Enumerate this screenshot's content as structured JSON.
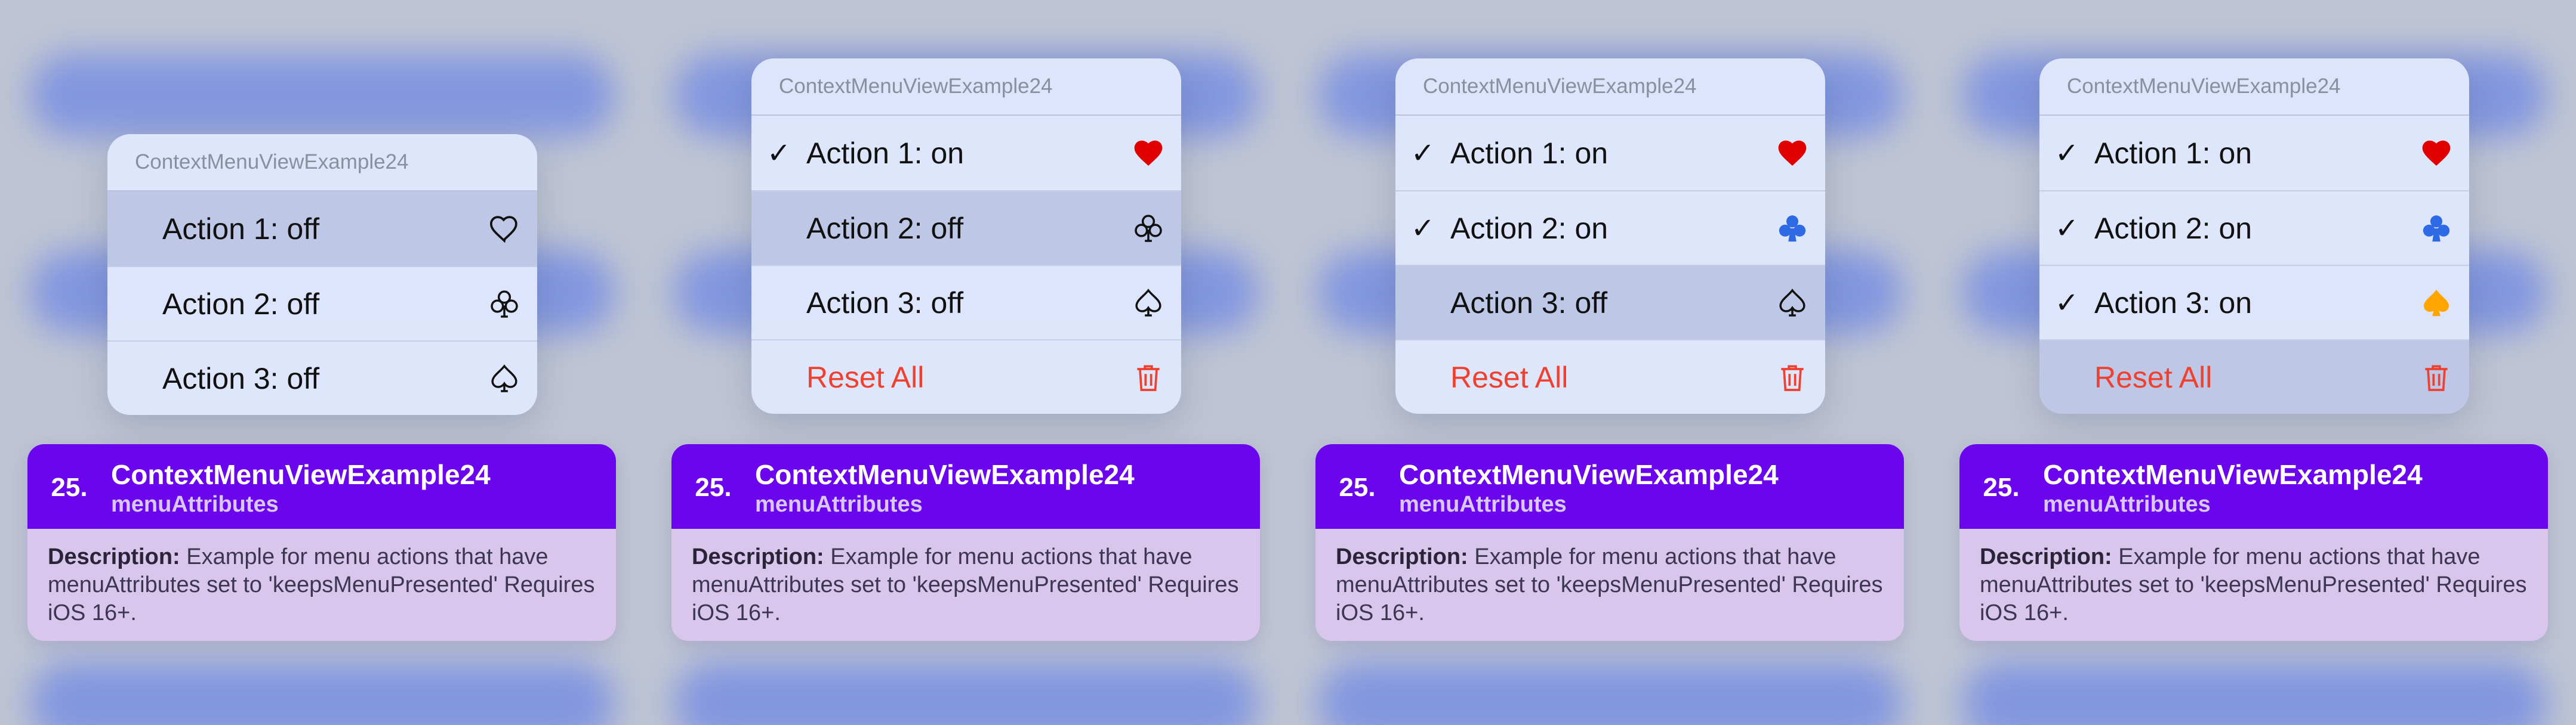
{
  "colors": {
    "accent": "#6a05ee",
    "destructive": "#f0402f",
    "heart": "#e00000",
    "club": "#2f6ae6",
    "spade": "#ffa500"
  },
  "panels": [
    {
      "menu": {
        "title": "ContextMenuViewExample24",
        "items": [
          {
            "check": "",
            "label": "Action 1: off",
            "icon": "heart-outline-icon"
          },
          {
            "check": "",
            "label": "Action 2: off",
            "icon": "club-outline-icon"
          },
          {
            "check": "",
            "label": "Action 3: off",
            "icon": "spade-outline-icon"
          }
        ]
      },
      "card": {
        "number": "25.",
        "title": "ContextMenuViewExample24",
        "subtitle": "menuAttributes",
        "description_label": "Description:",
        "description": "Example for menu actions that have menuAttributes set to 'keepsMenuPresented' Requires iOS 16+."
      }
    },
    {
      "menu": {
        "title": "ContextMenuViewExample24",
        "items": [
          {
            "check": "✓",
            "label": "Action 1: on",
            "icon": "heart-filled-icon"
          },
          {
            "check": "",
            "label": "Action 2: off",
            "icon": "club-outline-icon"
          },
          {
            "check": "",
            "label": "Action 3: off",
            "icon": "spade-outline-icon"
          },
          {
            "check": "",
            "label": "Reset All",
            "icon": "trash-icon"
          }
        ]
      },
      "card": {
        "number": "25.",
        "title": "ContextMenuViewExample24",
        "subtitle": "menuAttributes",
        "description_label": "Description:",
        "description": "Example for menu actions that have menuAttributes set to 'keepsMenuPresented' Requires iOS 16+."
      }
    },
    {
      "menu": {
        "title": "ContextMenuViewExample24",
        "items": [
          {
            "check": "✓",
            "label": "Action 1: on",
            "icon": "heart-filled-icon"
          },
          {
            "check": "✓",
            "label": "Action 2: on",
            "icon": "club-filled-icon"
          },
          {
            "check": "",
            "label": "Action 3: off",
            "icon": "spade-outline-icon"
          },
          {
            "check": "",
            "label": "Reset All",
            "icon": "trash-icon"
          }
        ]
      },
      "card": {
        "number": "25.",
        "title": "ContextMenuViewExample24",
        "subtitle": "menuAttributes",
        "description_label": "Description:",
        "description": "Example for menu actions that have menuAttributes set to 'keepsMenuPresented' Requires iOS 16+."
      }
    },
    {
      "menu": {
        "title": "ContextMenuViewExample24",
        "items": [
          {
            "check": "✓",
            "label": "Action 1: on",
            "icon": "heart-filled-icon"
          },
          {
            "check": "✓",
            "label": "Action 2: on",
            "icon": "club-filled-icon"
          },
          {
            "check": "✓",
            "label": "Action 3: on",
            "icon": "spade-filled-icon"
          },
          {
            "check": "",
            "label": "Reset All",
            "icon": "trash-icon"
          }
        ]
      },
      "card": {
        "number": "25.",
        "title": "ContextMenuViewExample24",
        "subtitle": "menuAttributes",
        "description_label": "Description:",
        "description": "Example for menu actions that have menuAttributes set to 'keepsMenuPresented' Requires iOS 16+."
      }
    }
  ]
}
